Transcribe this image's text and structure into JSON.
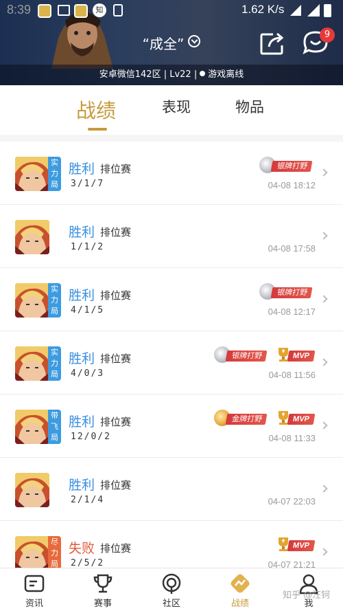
{
  "status_bar": {
    "time": "8:39",
    "network_speed": "1.62 K/s",
    "notification_icons": [
      "app-icon",
      "image-icon",
      "app-icon",
      "zhihu-icon",
      "phone-icon"
    ]
  },
  "header": {
    "title": "“成全”",
    "subtitle_server": "安卓微信142区 | Lv22 |",
    "subtitle_status": "游戏离线",
    "message_badge": "9"
  },
  "tabs": [
    {
      "label": "战绩",
      "active": true
    },
    {
      "label": "表现",
      "active": false
    },
    {
      "label": "物品",
      "active": false
    }
  ],
  "matches": [
    {
      "result": "胜利",
      "win": true,
      "type": "排位赛",
      "kda": "3/1/7",
      "time": "04-08 18:12",
      "tag": "实力局",
      "tag_color": "#3d9be0",
      "badges": [
        {
          "kind": "medal",
          "tier": "silver",
          "text": "银牌打野"
        }
      ]
    },
    {
      "result": "胜利",
      "win": true,
      "type": "排位赛",
      "kda": "1/1/2",
      "time": "04-08 17:58",
      "tag": "",
      "tag_color": "",
      "badges": []
    },
    {
      "result": "胜利",
      "win": true,
      "type": "排位赛",
      "kda": "4/1/5",
      "time": "04-08 12:17",
      "tag": "实力局",
      "tag_color": "#3d9be0",
      "badges": [
        {
          "kind": "medal",
          "tier": "silver",
          "text": "银牌打野"
        }
      ]
    },
    {
      "result": "胜利",
      "win": true,
      "type": "排位赛",
      "kda": "4/0/3",
      "time": "04-08 11:56",
      "tag": "实力局",
      "tag_color": "#3d9be0",
      "badges": [
        {
          "kind": "medal",
          "tier": "silver",
          "text": "银牌打野"
        },
        {
          "kind": "mvp",
          "text": "MVP"
        }
      ]
    },
    {
      "result": "胜利",
      "win": true,
      "type": "排位赛",
      "kda": "12/0/2",
      "time": "04-08 11:33",
      "tag": "带飞局",
      "tag_color": "#3d9be0",
      "badges": [
        {
          "kind": "medal",
          "tier": "gold",
          "text": "金牌打野"
        },
        {
          "kind": "mvp",
          "text": "MVP"
        }
      ]
    },
    {
      "result": "胜利",
      "win": true,
      "type": "排位赛",
      "kda": "2/1/4",
      "time": "04-07 22:03",
      "tag": "",
      "tag_color": "",
      "badges": []
    },
    {
      "result": "失败",
      "win": false,
      "type": "排位赛",
      "kda": "2/5/2",
      "time": "04-07 21:21",
      "tag": "尽力局",
      "tag_color": "#e86a3c",
      "badges": [
        {
          "kind": "mvp",
          "text": "MVP"
        }
      ]
    }
  ],
  "bottom_nav": [
    {
      "label": "资讯",
      "icon": "news-icon",
      "active": false
    },
    {
      "label": "赛事",
      "icon": "trophy-icon",
      "active": false
    },
    {
      "label": "社区",
      "icon": "community-icon",
      "active": false
    },
    {
      "label": "战绩",
      "icon": "record-icon",
      "active": true
    },
    {
      "label": "我",
      "icon": "profile-icon",
      "active": false
    }
  ],
  "watermark": "知乎 @汪钶",
  "colors": {
    "accent": "#c59a3e",
    "win": "#3a8ee0",
    "lose": "#e25a3a",
    "badge": "#e8393a"
  }
}
